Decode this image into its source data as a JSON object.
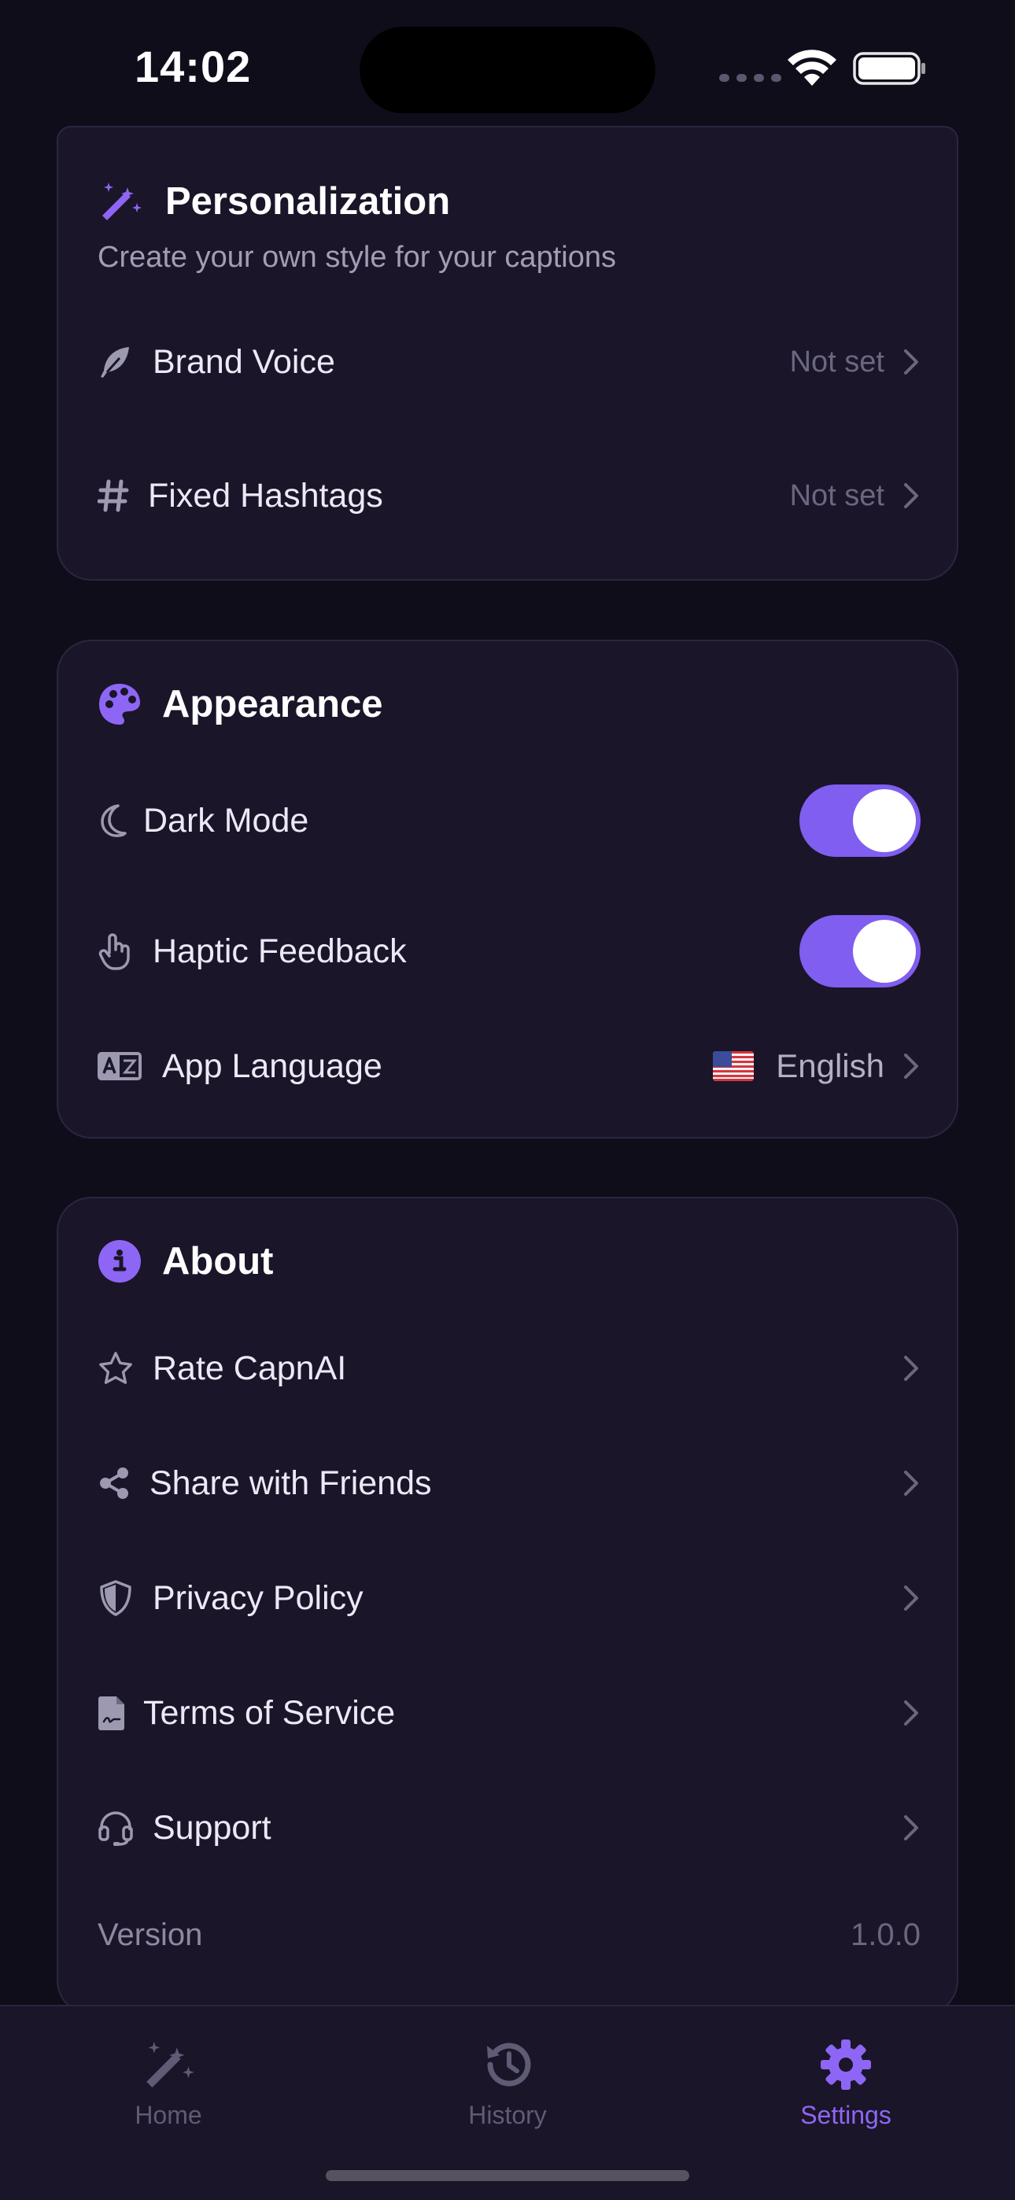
{
  "status_bar": {
    "time": "14:02"
  },
  "personalization": {
    "title": "Personalization",
    "subtitle": "Create your own style for your captions",
    "rows": [
      {
        "label": "Brand Voice",
        "value": "Not set"
      },
      {
        "label": "Fixed Hashtags",
        "value": "Not set"
      }
    ]
  },
  "appearance": {
    "title": "Appearance",
    "dark_mode": {
      "label": "Dark Mode",
      "enabled": true
    },
    "haptic": {
      "label": "Haptic Feedback",
      "enabled": true
    },
    "language": {
      "label": "App Language",
      "value": "English",
      "flag_icon": "us-flag-icon"
    }
  },
  "about": {
    "title": "About",
    "rows": [
      {
        "label": "Rate CapnAI",
        "icon": "star-icon"
      },
      {
        "label": "Share with Friends",
        "icon": "share-icon"
      },
      {
        "label": "Privacy Policy",
        "icon": "shield-icon"
      },
      {
        "label": "Terms of Service",
        "icon": "document-icon"
      },
      {
        "label": "Support",
        "icon": "headset-icon"
      }
    ],
    "version": {
      "label": "Version",
      "value": "1.0.0"
    }
  },
  "tabbar": {
    "tabs": [
      {
        "label": "Home",
        "icon": "magic-wand-icon",
        "active": false
      },
      {
        "label": "History",
        "icon": "history-icon",
        "active": false
      },
      {
        "label": "Settings",
        "icon": "gear-icon",
        "active": true
      }
    ]
  },
  "colors": {
    "background": "#100d1b",
    "card": "#1a1528",
    "accent": "#7f5ef0",
    "muted_text": "#6b6780"
  }
}
